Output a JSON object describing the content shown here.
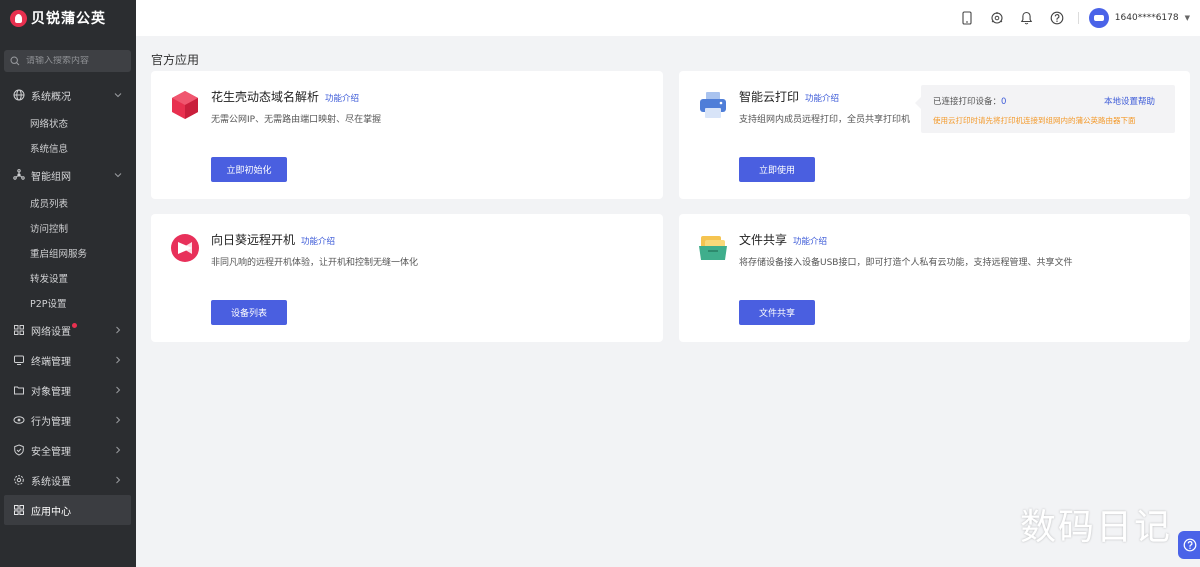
{
  "brand": {
    "name": "贝锐蒲公英"
  },
  "search": {
    "placeholder": "请输入搜索内容"
  },
  "sidebar": {
    "groups": [
      {
        "label": "系统概况",
        "icon": "globe-icon",
        "expanded": true,
        "children": [
          "网络状态",
          "系统信息"
        ]
      },
      {
        "label": "智能组网",
        "icon": "network-icon",
        "expanded": true,
        "children": [
          "成员列表",
          "访问控制",
          "重启组网服务",
          "转发设置",
          "P2P设置"
        ]
      },
      {
        "label": "网络设置",
        "icon": "network-settings-icon",
        "badge_dot": true
      },
      {
        "label": "终端管理",
        "icon": "terminal-icon"
      },
      {
        "label": "对象管理",
        "icon": "folder-icon"
      },
      {
        "label": "行为管理",
        "icon": "eye-icon"
      },
      {
        "label": "安全管理",
        "icon": "shield-icon"
      },
      {
        "label": "系统设置",
        "icon": "gear-icon"
      },
      {
        "label": "应用中心",
        "icon": "apps-icon",
        "active": true
      }
    ]
  },
  "header": {
    "icons": [
      "phone-icon",
      "router-icon",
      "bell-icon",
      "help-icon"
    ],
    "user": {
      "name": "1640****6178"
    }
  },
  "main": {
    "title": "官方应用",
    "cards": [
      {
        "id": "ddns",
        "title": "花生壳动态域名解析",
        "link": "功能介绍",
        "desc": "无需公网IP、无需路由端口映射、尽在掌握",
        "button": "立即初始化",
        "icon": "peanut-shell-icon"
      },
      {
        "id": "print",
        "title": "智能云打印",
        "link": "功能介绍",
        "desc": "支持组网内成员远程打印，全员共享打印机",
        "button": "立即使用",
        "icon": "printer-icon",
        "info": {
          "label": "已连接打印设备：",
          "count": "0",
          "help": "本地设置帮助",
          "warning": "使用云打印时请先将打印机连接到组网内的蒲公英路由器下面"
        }
      },
      {
        "id": "sunlogin",
        "title": "向日葵远程开机",
        "link": "功能介绍",
        "desc": "非同凡响的远程开机体验，让开机和控制无缝一体化",
        "button": "设备列表",
        "icon": "sunflower-icon"
      },
      {
        "id": "share",
        "title": "文件共享",
        "link": "功能介绍",
        "desc": "将存储设备接入设备USB接口，即可打造个人私有云功能，支持远程管理、共享文件",
        "button": "文件共享",
        "icon": "file-share-icon"
      }
    ]
  },
  "watermark": "数码日记",
  "colors": {
    "accent": "#4a5fe0",
    "brand": "#e8304f",
    "sidebar_bg": "#2b2d30",
    "warning": "#f39a2b"
  }
}
